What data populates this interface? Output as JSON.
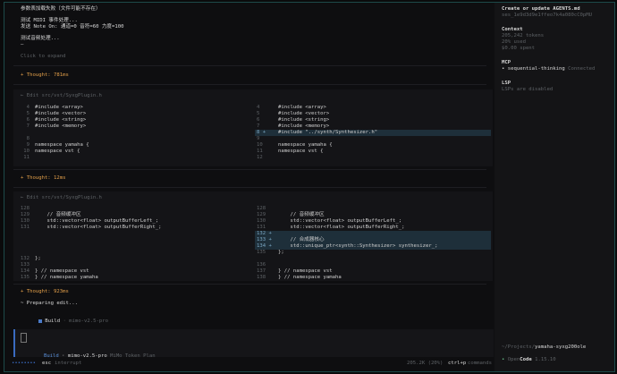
{
  "log": {
    "line1": "参数表加载失败（文件可能不存在）",
    "line2": "测试 MIDI 事件处理...",
    "line3": "发送 Note On: 通道=0 音符=60 力度=100",
    "line4": "测试音频处理...",
    "line5": "–",
    "expand": "Click to expand"
  },
  "thought1": "+ Thought: 781ms",
  "edit1": {
    "header": "← Edit src/vst/SyxgPlugin.h",
    "left": [
      {
        "n": "4",
        "t": "#include <array>"
      },
      {
        "n": "5",
        "t": "#include <vector>"
      },
      {
        "n": "6",
        "t": "#include <string>"
      },
      {
        "n": "7",
        "t": "#include <memory>"
      },
      {
        "n": "",
        "t": ""
      },
      {
        "n": "8",
        "t": ""
      },
      {
        "n": "9",
        "t": "namespace yamaha {"
      },
      {
        "n": "10",
        "t": "namespace vst {"
      },
      {
        "n": "11",
        "t": ""
      }
    ],
    "right": [
      {
        "n": "4",
        "t": "#include <array>",
        "add": false
      },
      {
        "n": "5",
        "t": "#include <vector>",
        "add": false
      },
      {
        "n": "6",
        "t": "#include <string>",
        "add": false
      },
      {
        "n": "7",
        "t": "#include <memory>",
        "add": false
      },
      {
        "n": "8 +",
        "t": "#include \"../synth/Synthesizer.h\"",
        "add": true
      },
      {
        "n": "9",
        "t": "",
        "add": false
      },
      {
        "n": "10",
        "t": "namespace yamaha {",
        "add": false
      },
      {
        "n": "11",
        "t": "namespace vst {",
        "add": false
      },
      {
        "n": "12",
        "t": "",
        "add": false
      }
    ]
  },
  "thought2": "+ Thought: 12ms",
  "edit2": {
    "header": "← Edit src/vst/SyxgPlugin.h",
    "left": [
      {
        "n": "128",
        "t": ""
      },
      {
        "n": "129",
        "t": "    // 音频缓冲区"
      },
      {
        "n": "130",
        "t": "    std::vector<float> outputBufferLeft_;"
      },
      {
        "n": "131",
        "t": "    std::vector<float> outputBufferRight_;"
      },
      {
        "n": "",
        "t": ""
      },
      {
        "n": "",
        "t": ""
      },
      {
        "n": "",
        "t": ""
      },
      {
        "n": "",
        "t": ""
      },
      {
        "n": "132",
        "t": "};"
      },
      {
        "n": "133",
        "t": ""
      },
      {
        "n": "134",
        "t": "} // namespace vst"
      },
      {
        "n": "135",
        "t": "} // namespace yamaha"
      }
    ],
    "right": [
      {
        "n": "128",
        "t": "",
        "add": false
      },
      {
        "n": "129",
        "t": "    // 音频缓冲区",
        "add": false
      },
      {
        "n": "130",
        "t": "    std::vector<float> outputBufferLeft_;",
        "add": false
      },
      {
        "n": "131",
        "t": "    std::vector<float> outputBufferRight_;",
        "add": false
      },
      {
        "n": "132 +",
        "t": "",
        "add": true
      },
      {
        "n": "133 +",
        "t": "    // 合成器核心",
        "add": true
      },
      {
        "n": "134 +",
        "t": "    std::unique_ptr<synth::Synthesizer> synthesizer_;",
        "add": true
      },
      {
        "n": "135",
        "t": "};",
        "add": false
      },
      {
        "n": "",
        "t": "",
        "add": false
      },
      {
        "n": "136",
        "t": "",
        "add": false
      },
      {
        "n": "137",
        "t": "} // namespace vst",
        "add": false
      },
      {
        "n": "138",
        "t": "} // namespace yamaha",
        "add": false
      }
    ]
  },
  "thought3": "+ Thought: 923ms",
  "preparing": "~ Preparing edit...",
  "build_status": {
    "label": "Build",
    "model": "· mimo-v2.5-pro"
  },
  "input": {
    "mode": "Build",
    "model": "· mimo-v2.5-pro",
    "plan": "MiMo Token Plan"
  },
  "statusbar": {
    "dots": "••••••••",
    "esc_key": "esc",
    "esc_label": "interrupt",
    "tokens": "205.2K (20%)",
    "cmd_key": "ctrl+p",
    "cmd_label": "commands"
  },
  "sidebar": {
    "title": "Create or update AGENTS.md",
    "session": "ses_1e9d3d9e1ffeo7k4a080cC0pMU",
    "context_label": "Context",
    "tokens": "205,242 tokens",
    "used": "20% used",
    "spent": "$0.00 spent",
    "mcp_label": "MCP",
    "mcp_item": "• sequential-thinking",
    "mcp_status": "Connected",
    "lsp_label": "LSP",
    "lsp_status": "LSPs are disabled",
    "path_prefix": "~/Projects/",
    "path_name": "yamaha-syxg200ole",
    "app_dot": "•",
    "app_open": "Open",
    "app_code": "Code",
    "app_version": "1.15.10"
  },
  "colors": {
    "accent": "#e4a04a",
    "added": "#1e2f3a",
    "input_border": "#3a6bc0",
    "frame": "#1d4a4a"
  }
}
